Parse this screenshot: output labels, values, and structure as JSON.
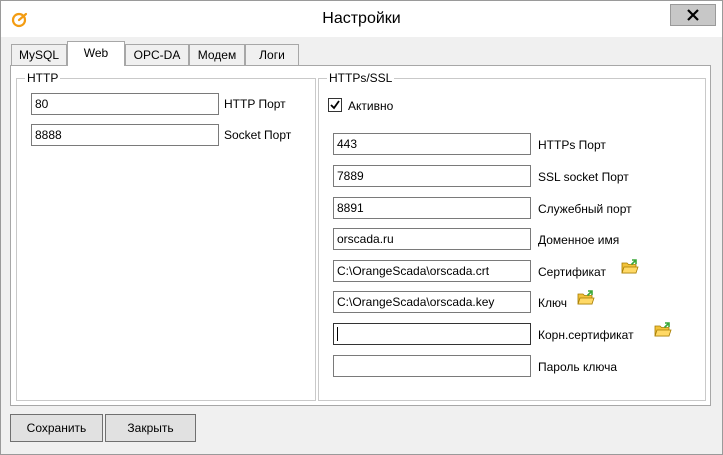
{
  "window": {
    "title": "Настройки"
  },
  "tabs": [
    {
      "label": "MySQL",
      "active": false
    },
    {
      "label": "Web",
      "active": true
    },
    {
      "label": "OPC-DA",
      "active": false
    },
    {
      "label": "Модем",
      "active": false
    },
    {
      "label": "Логи",
      "active": false
    }
  ],
  "http": {
    "legend": "HTTP",
    "http_port_value": "80",
    "http_port_label": "HTTP Порт",
    "socket_port_value": "8888",
    "socket_port_label": "Socket Порт"
  },
  "https": {
    "legend": "HTTPs/SSL",
    "active_label": "Активно",
    "active_checked": true,
    "https_port_value": "443",
    "https_port_label": "HTTPs Порт",
    "ssl_socket_value": "7889",
    "ssl_socket_label": "SSL socket Порт",
    "service_port_value": "8891",
    "service_port_label": "Служебный порт",
    "domain_value": "orscada.ru",
    "domain_label": "Доменное имя",
    "cert_value": "C:\\OrangeScada\\orscada.crt",
    "cert_label": "Сертификат",
    "key_value": "C:\\OrangeScada\\orscada.key",
    "key_label": "Ключ",
    "root_cert_value": "",
    "root_cert_label": "Корн.сертификат",
    "key_password_value": "",
    "key_password_label": "Пароль ключа"
  },
  "buttons": {
    "save": "Сохранить",
    "close": "Закрыть"
  },
  "colors": {
    "app_icon": "#f39c12",
    "folder": "#f2c23a",
    "folder_arrow": "#3aa83a"
  },
  "icons": {
    "app": "orange-scada-logo-icon",
    "close": "close-icon",
    "folder": "folder-open-icon",
    "check": "checkmark-icon"
  }
}
